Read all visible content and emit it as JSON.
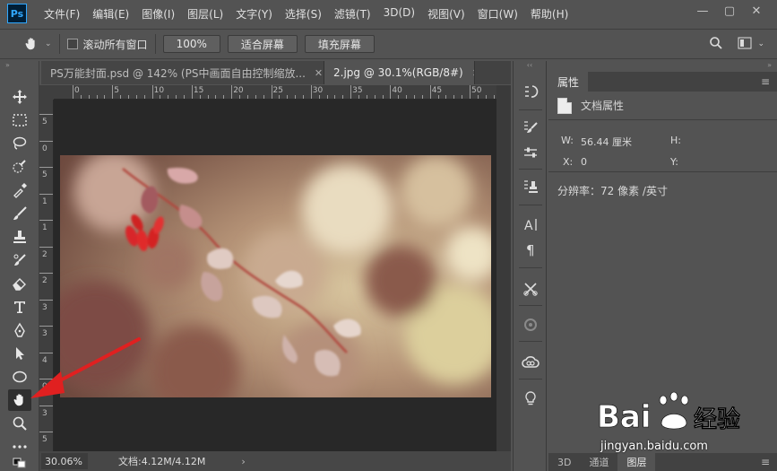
{
  "app": {
    "logo": "Ps"
  },
  "menu": [
    "文件(F)",
    "编辑(E)",
    "图像(I)",
    "图层(L)",
    "文字(Y)",
    "选择(S)",
    "滤镜(T)",
    "3D(D)",
    "视图(V)",
    "窗口(W)",
    "帮助(H)"
  ],
  "window_controls": {
    "minimize": "—",
    "restore": "▢",
    "close": "✕"
  },
  "options": {
    "scroll_all_label": "滚动所有窗口",
    "zoom_btn": "100%",
    "fit_btn": "适合屏幕",
    "fill_btn": "填充屏幕"
  },
  "tabs": [
    {
      "label": "PS万能封面.psd @ 142% (PS中画面自由控制缩放...",
      "close": "✕"
    },
    {
      "label": "2.jpg @ 30.1%(RGB/8#)",
      "close": "✕"
    }
  ],
  "ruler": {
    "top": [
      "0",
      "5",
      "10",
      "15",
      "20",
      "25",
      "30",
      "35",
      "40",
      "45",
      "50",
      "55"
    ],
    "left": [
      "5",
      "0",
      "5",
      "1",
      "1",
      "2",
      "2",
      "3",
      "3",
      "4",
      "0",
      "3",
      "5"
    ]
  },
  "status": {
    "zoom": "30.06%",
    "doc": "文档:4.12M/4.12M",
    "arrow": "›"
  },
  "panel": {
    "tab": "属性",
    "title": "文档属性",
    "w_label": "W:",
    "w_value": "56.44 厘米",
    "h_label": "H:",
    "x_label": "X:",
    "x_value": "0",
    "y_label": "Y:",
    "resolution": "分辨率：72 像素 /英寸",
    "bottom_tabs": [
      "3D",
      "通道",
      "图层"
    ]
  },
  "watermark": {
    "brand": "Baidu经验",
    "site": "jingyan.baidu.com"
  },
  "colors": {
    "accent": "#31a8ff",
    "arrow": "#e02020"
  }
}
